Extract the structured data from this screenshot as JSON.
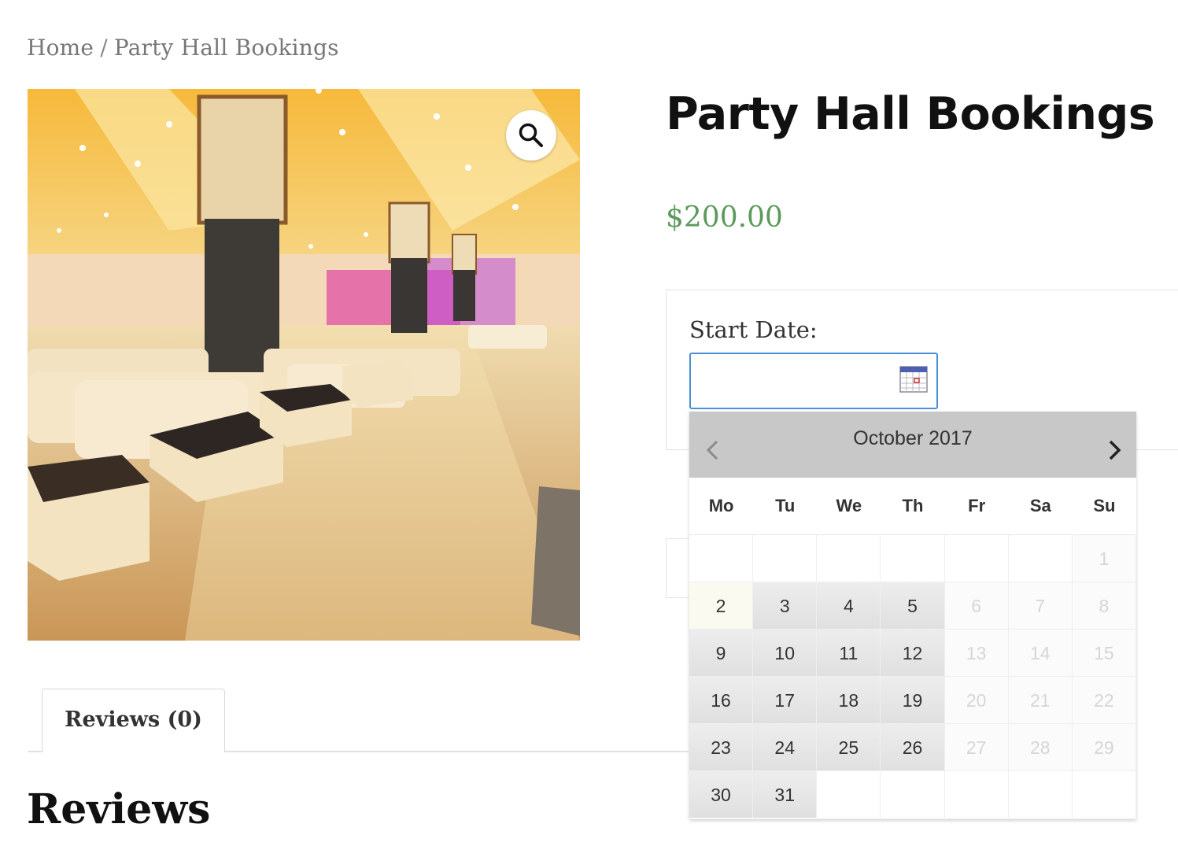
{
  "breadcrumb": {
    "home": "Home",
    "separator": "/",
    "current": "Party Hall Bookings"
  },
  "product": {
    "title": "Party Hall Bookings",
    "price": "$200.00",
    "image_alt": "Party hall interior",
    "zoom_icon": "search-icon"
  },
  "booking": {
    "start_date_label": "Start Date:",
    "start_date_value": "",
    "calendar_icon": "calendar-icon"
  },
  "datepicker": {
    "month_label": "October 2017",
    "prev_icon": "chevron-left-icon",
    "next_icon": "chevron-right-icon",
    "weekdays": [
      "Mo",
      "Tu",
      "We",
      "Th",
      "Fr",
      "Sa",
      "Su"
    ],
    "weeks": [
      [
        {
          "d": "",
          "s": "empty"
        },
        {
          "d": "",
          "s": "empty"
        },
        {
          "d": "",
          "s": "empty"
        },
        {
          "d": "",
          "s": "empty"
        },
        {
          "d": "",
          "s": "empty"
        },
        {
          "d": "",
          "s": "empty"
        },
        {
          "d": "1",
          "s": "disabled"
        }
      ],
      [
        {
          "d": "2",
          "s": "today"
        },
        {
          "d": "3",
          "s": "avail"
        },
        {
          "d": "4",
          "s": "avail"
        },
        {
          "d": "5",
          "s": "avail"
        },
        {
          "d": "6",
          "s": "disabled"
        },
        {
          "d": "7",
          "s": "disabled"
        },
        {
          "d": "8",
          "s": "disabled"
        }
      ],
      [
        {
          "d": "9",
          "s": "avail"
        },
        {
          "d": "10",
          "s": "avail"
        },
        {
          "d": "11",
          "s": "avail"
        },
        {
          "d": "12",
          "s": "avail"
        },
        {
          "d": "13",
          "s": "disabled"
        },
        {
          "d": "14",
          "s": "disabled"
        },
        {
          "d": "15",
          "s": "disabled"
        }
      ],
      [
        {
          "d": "16",
          "s": "avail"
        },
        {
          "d": "17",
          "s": "avail"
        },
        {
          "d": "18",
          "s": "avail"
        },
        {
          "d": "19",
          "s": "avail"
        },
        {
          "d": "20",
          "s": "disabled"
        },
        {
          "d": "21",
          "s": "disabled"
        },
        {
          "d": "22",
          "s": "disabled"
        }
      ],
      [
        {
          "d": "23",
          "s": "avail"
        },
        {
          "d": "24",
          "s": "avail"
        },
        {
          "d": "25",
          "s": "avail"
        },
        {
          "d": "26",
          "s": "avail"
        },
        {
          "d": "27",
          "s": "disabled"
        },
        {
          "d": "28",
          "s": "disabled"
        },
        {
          "d": "29",
          "s": "disabled"
        }
      ],
      [
        {
          "d": "30",
          "s": "avail"
        },
        {
          "d": "31",
          "s": "avail"
        },
        {
          "d": "",
          "s": "empty"
        },
        {
          "d": "",
          "s": "empty"
        },
        {
          "d": "",
          "s": "empty"
        },
        {
          "d": "",
          "s": "empty"
        },
        {
          "d": "",
          "s": "empty"
        }
      ]
    ]
  },
  "tabs": {
    "reviews_label": "Reviews (0)"
  },
  "reviews": {
    "heading": "Reviews"
  },
  "colors": {
    "price": "#5c9a5c",
    "input_focus": "#4a90d9",
    "datepicker_header": "#c8c8c8"
  }
}
